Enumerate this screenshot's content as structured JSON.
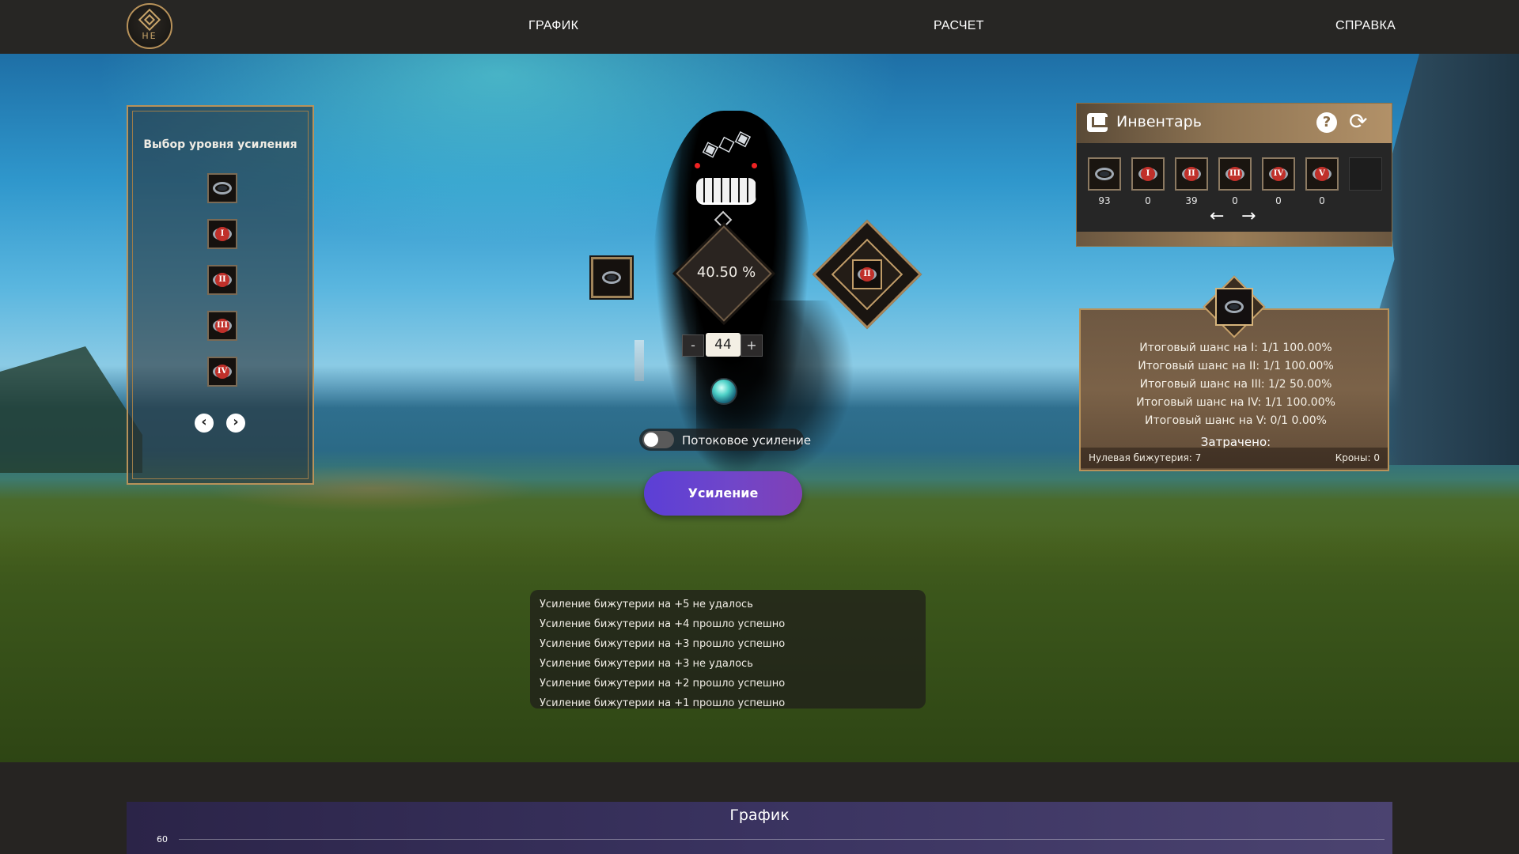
{
  "nav": {
    "logo_text": "HE",
    "links": [
      "ГРАФИК",
      "РАСЧЕТ",
      "СПРАВКА"
    ]
  },
  "level_select": {
    "title": "Выбор уровня усиления",
    "items": [
      {
        "level": ""
      },
      {
        "level": "I"
      },
      {
        "level": "II"
      },
      {
        "level": "III"
      },
      {
        "level": "IV"
      }
    ],
    "prev_icon": "chevron-left-icon",
    "next_icon": "chevron-right-icon"
  },
  "enhance": {
    "chance": "40.50 %",
    "failstack": "44",
    "minus": "-",
    "plus": "+",
    "target_level": "II",
    "stream_label": "Потоковое усиление",
    "stream_on": false,
    "button_label": "Усиление"
  },
  "inventory": {
    "title": "Инвентарь",
    "items": [
      {
        "level": "",
        "count": "93"
      },
      {
        "level": "I",
        "count": "0"
      },
      {
        "level": "II",
        "count": "39"
      },
      {
        "level": "III",
        "count": "0"
      },
      {
        "level": "IV",
        "count": "0"
      },
      {
        "level": "V",
        "count": "0"
      }
    ],
    "prev_arrow": "←",
    "next_arrow": "→"
  },
  "result": {
    "lines": [
      "Итоговый шанс на I: 1/1   100.00%",
      "Итоговый шанс на II: 1/1   100.00%",
      "Итоговый шанс на III: 1/2   50.00%",
      "Итоговый шанс на IV: 1/1   100.00%",
      "Итоговый шанс на V: 0/1   0.00%"
    ],
    "spent_label": "Затрачено:",
    "base_jewelry": "Нулевая бижутерия: 7",
    "crowns": "Кроны: 0"
  },
  "log": [
    "Усиление бижутерии на +5 не удалось",
    "Усиление бижутерии на +4 прошло успешно",
    "Усиление бижутерии на +3 прошло успешно",
    "Усиление бижутерии на +3 не удалось",
    "Усиление бижутерии на +2 прошло успешно",
    "Усиление бижутерии на +1 прошло успешно"
  ],
  "chart": {
    "title": "График",
    "y_tick": "60"
  },
  "colors": {
    "accent_gold": "#b8925a",
    "button_purple": "#6a43cf",
    "level_red": "#c0302a"
  }
}
